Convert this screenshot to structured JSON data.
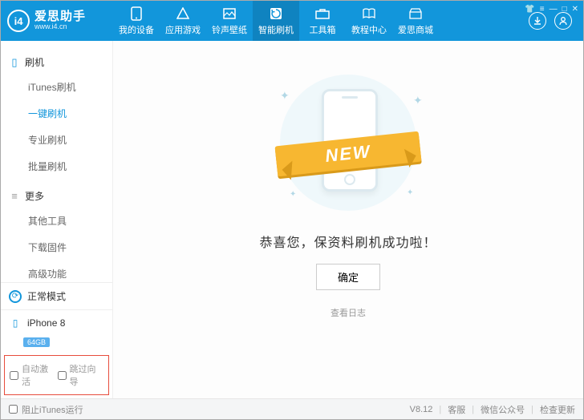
{
  "logo": {
    "title": "爱思助手",
    "url": "www.i4.cn",
    "mark": "i4"
  },
  "nav": [
    {
      "label": "我的设备"
    },
    {
      "label": "应用游戏"
    },
    {
      "label": "铃声壁纸"
    },
    {
      "label": "智能刷机"
    },
    {
      "label": "工具箱"
    },
    {
      "label": "教程中心"
    },
    {
      "label": "爱思商城"
    }
  ],
  "sidebar": {
    "group_flash": "刷机",
    "flash_items": [
      "iTunes刷机",
      "一键刷机",
      "专业刷机",
      "批量刷机"
    ],
    "group_more": "更多",
    "more_items": [
      "其他工具",
      "下载固件",
      "高级功能"
    ],
    "mode": "正常模式",
    "device": "iPhone 8",
    "storage": "64GB",
    "auto_activate": "自动激活",
    "skip_guide": "跳过向导"
  },
  "content": {
    "ribbon": "NEW",
    "message": "恭喜您，保资料刷机成功啦！",
    "ok": "确定",
    "log": "查看日志"
  },
  "footer": {
    "block_itunes": "阻止iTunes运行",
    "version": "V8.12",
    "support": "客服",
    "wechat": "微信公众号",
    "update": "检查更新"
  }
}
